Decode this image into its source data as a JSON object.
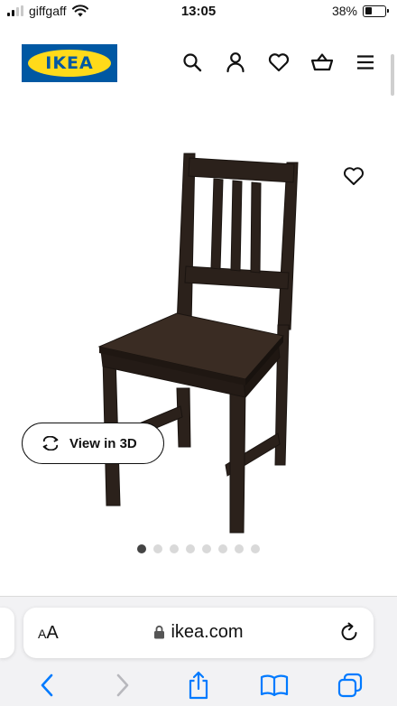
{
  "status_bar": {
    "carrier": "giffgaff",
    "time": "13:05",
    "battery_percent": "38%",
    "battery_level": 0.38,
    "signal_bars_active": 2
  },
  "header": {
    "logo_text": "IKEA",
    "icons": [
      "search-icon",
      "account-icon",
      "wishlist-icon",
      "basket-icon",
      "menu-icon"
    ]
  },
  "product": {
    "view_3d_label": "View in 3D",
    "image_count": 8,
    "active_image_index": 0
  },
  "browser": {
    "text_size_label_small": "A",
    "text_size_label_large": "A",
    "url": "ikea.com"
  },
  "colors": {
    "ikea_blue": "#0058a3",
    "ikea_yellow": "#ffda1a",
    "ios_blue": "#007aff",
    "chair_wood": "#2b211b"
  }
}
